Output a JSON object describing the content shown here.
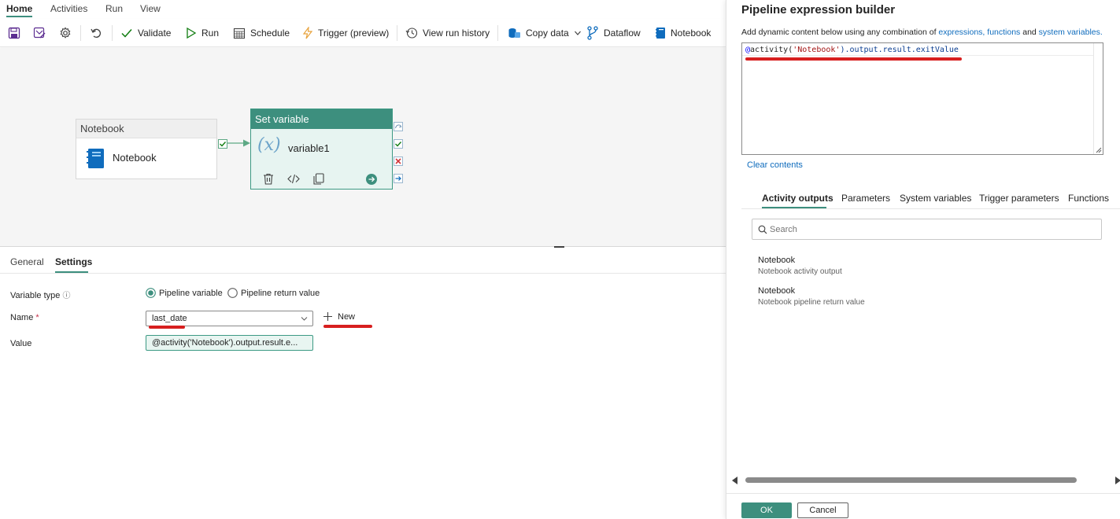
{
  "menu_tabs": [
    "Home",
    "Activities",
    "Run",
    "View"
  ],
  "ribbon": {
    "validate": "Validate",
    "run": "Run",
    "schedule": "Schedule",
    "trigger": "Trigger (preview)",
    "view_run_history": "View run history",
    "copy_data": "Copy data",
    "dataflow": "Dataflow",
    "notebook": "Notebook"
  },
  "canvas": {
    "notebook_card_title": "Notebook",
    "notebook_card_label": "Notebook",
    "setvar_card_title": "Set variable",
    "setvar_symbol": "(x)",
    "setvar_label": "variable1"
  },
  "bottom_tabs": {
    "general": "General",
    "settings": "Settings"
  },
  "form": {
    "variable_type_label": "Variable type",
    "info_glyph": "ⓘ",
    "radio_pipeline_variable": "Pipeline variable",
    "radio_pipeline_return": "Pipeline return value",
    "name_label": "Name",
    "required_mark": "*",
    "name_value": "last_date",
    "new_label": "New",
    "value_label": "Value",
    "value_text": "@activity('Notebook').output.result.e..."
  },
  "panel": {
    "title": "Pipeline expression builder",
    "desc_prefix": "Add dynamic content below using any combination of ",
    "desc_link1": "expressions,",
    "desc_link2": "functions",
    "desc_and": " and ",
    "desc_link3": "system variables.",
    "expr_at": "@",
    "expr_fn": "activity(",
    "expr_arg": "'Notebook'",
    "expr_rest": ").output.result.exitValue",
    "clear_contents": "Clear contents",
    "tabs": [
      "Activity outputs",
      "Parameters",
      "System variables",
      "Trigger parameters",
      "Functions"
    ],
    "search_placeholder": "Search",
    "results": [
      {
        "title": "Notebook",
        "subtitle": "Notebook activity output"
      },
      {
        "title": "Notebook",
        "subtitle": "Notebook pipeline return value"
      }
    ],
    "ok_label": "OK",
    "cancel_label": "Cancel"
  },
  "colors": {
    "accent": "#0f6cbd",
    "teal": "#3d8f7e",
    "annotation_red": "#d71f1f"
  }
}
